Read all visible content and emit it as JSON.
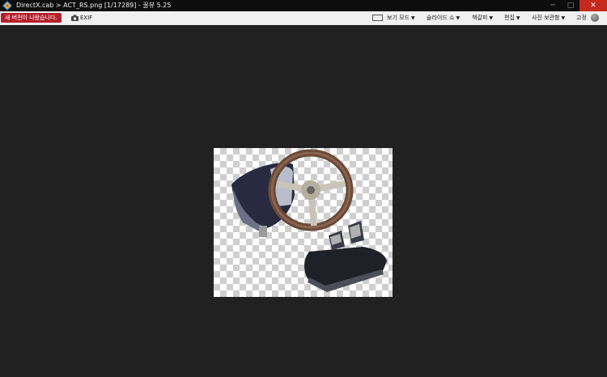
{
  "window": {
    "title": "DirectX.cab > ACT_RS.png [1/17289] - 꿀뷰 5.25",
    "minimize_glyph": "─",
    "maximize_glyph": "□",
    "close_glyph": "✕"
  },
  "toolbar": {
    "update_notice": "새 버전이 나왔습니다.",
    "exif_label": "EXIF",
    "view_mode": "보기 모드",
    "slideshow": "슬라이드 쇼",
    "bookmark": "책갈피",
    "edit": "편집",
    "photo_storage": "사진 보관함",
    "pin": "고정"
  },
  "colors": {
    "accent": "#b41f2b",
    "close": "#c42b1c",
    "background": "#212121"
  }
}
